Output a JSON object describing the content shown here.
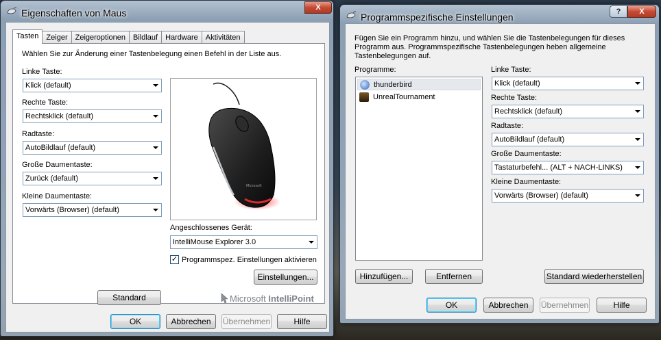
{
  "left_window": {
    "title": "Eigenschaften von Maus",
    "caption_close": "X",
    "tabs": [
      "Tasten",
      "Zeiger",
      "Zeigeroptionen",
      "Bildlauf",
      "Hardware",
      "Aktivitäten"
    ],
    "instruction": "Wählen Sie zur Änderung einer Tastenbelegung einen Befehl in der Liste aus.",
    "fields": [
      {
        "label": "Linke Taste:",
        "value": "Klick (default)"
      },
      {
        "label": "Rechte Taste:",
        "value": "Rechtsklick (default)"
      },
      {
        "label": "Radtaste:",
        "value": "AutoBildlauf (default)"
      },
      {
        "label": "Große Daumentaste:",
        "value": "Zurück (default)"
      },
      {
        "label": "Kleine Daumentaste:",
        "value": "Vorwärts (Browser) (default)"
      }
    ],
    "device_label": "Angeschlossenes Gerät:",
    "device_value": "IntelliMouse Explorer 3.0",
    "checkbox_label": "Programmspez. Einstellungen aktivieren",
    "checkbox_mark": "✓",
    "settings_button": "Einstellungen...",
    "standard_button": "Standard",
    "brand_prefix": "Microsoft",
    "brand_name": "IntelliPoint",
    "ok": "OK",
    "cancel": "Abbrechen",
    "apply": "Übernehmen",
    "help": "Hilfe"
  },
  "right_window": {
    "title": "Programmspezifische Einstellungen",
    "caption_help": "?",
    "caption_close": "X",
    "description": "Fügen Sie ein Programm hinzu, und wählen Sie die Tastenbelegungen für dieses Programm aus. Programmspezifische Tastenbelegungen heben allgemeine Tastenbelegungen auf.",
    "programs_label": "Programme:",
    "programs": [
      "thunderbird",
      "UnrealTournament"
    ],
    "fields": [
      {
        "label": "Linke Taste:",
        "value": "Klick (default)"
      },
      {
        "label": "Rechte Taste:",
        "value": "Rechtsklick (default)"
      },
      {
        "label": "Radtaste:",
        "value": "AutoBildlauf (default)"
      },
      {
        "label": "Große Daumentaste:",
        "value": "Tastaturbefehl... (ALT + NACH-LINKS)"
      },
      {
        "label": "Kleine Daumentaste:",
        "value": "Vorwärts (Browser) (default)"
      }
    ],
    "add_button": "Hinzufügen...",
    "remove_button": "Entfernen",
    "restore_button": "Standard wiederherstellen",
    "ok": "OK",
    "cancel": "Abbrechen",
    "apply": "Übernehmen",
    "help": "Hilfe"
  },
  "colors": {
    "accent": "#3c7fb1",
    "mouse_glow": "#d4202a"
  }
}
